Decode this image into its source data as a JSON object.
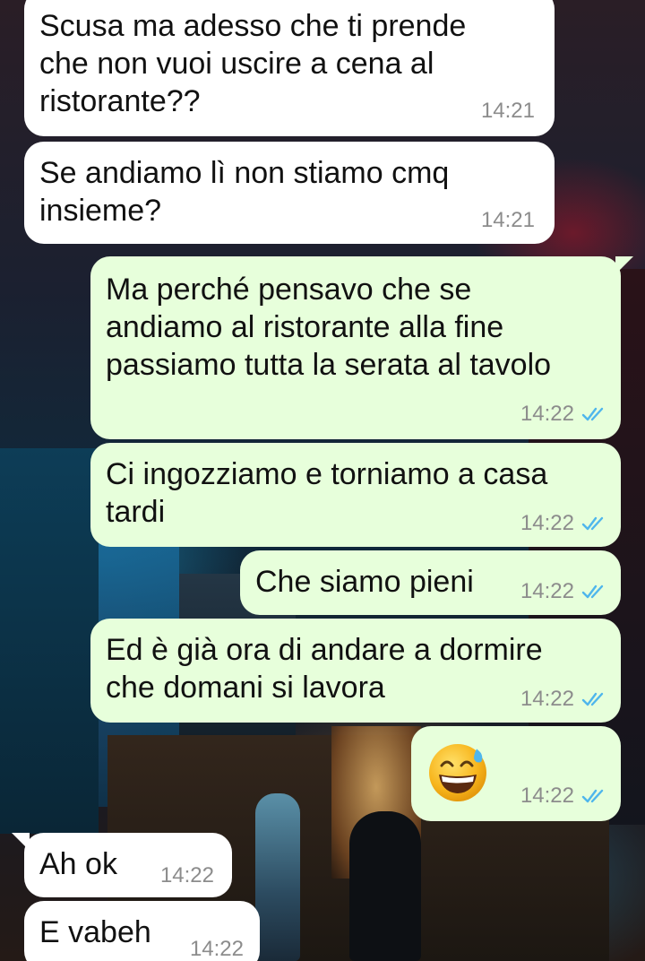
{
  "messages": [
    {
      "direction": "in",
      "text": "Scusa ma adesso che ti prende\nche non vuoi uscire a cena al\nristorante??",
      "time": "14:21"
    },
    {
      "direction": "in",
      "text": "Se andiamo lì non stiamo cmq\ninsieme?",
      "time": "14:21"
    },
    {
      "direction": "out",
      "text": "Ma perché pensavo che se\nandiamo al ristorante alla fine\npassiamo tutta la serata al tavolo",
      "time": "14:22",
      "status_icon": "double-check-read-icon"
    },
    {
      "direction": "out",
      "text": "Ci ingozziamo e torniamo a casa\ntardi",
      "time": "14:22",
      "status_icon": "double-check-read-icon"
    },
    {
      "direction": "out",
      "text": "Che siamo pieni",
      "time": "14:22",
      "status_icon": "double-check-read-icon"
    },
    {
      "direction": "out",
      "text": "Ed è già ora di andare a dormire\nche domani si lavora",
      "time": "14:22",
      "status_icon": "double-check-read-icon"
    },
    {
      "direction": "out",
      "emoji": "😅",
      "time": "14:22",
      "status_icon": "double-check-read-icon"
    },
    {
      "direction": "in",
      "text": "Ah ok",
      "time": "14:22"
    },
    {
      "direction": "in",
      "text": "E vabeh",
      "time": "14:22"
    }
  ],
  "colors": {
    "incoming_bubble": "#ffffff",
    "outgoing_bubble": "#e7ffdb",
    "timestamp": "#8c8c8c",
    "read_check": "#4fb6ec"
  },
  "wallpaper": "city-night-street-photo"
}
